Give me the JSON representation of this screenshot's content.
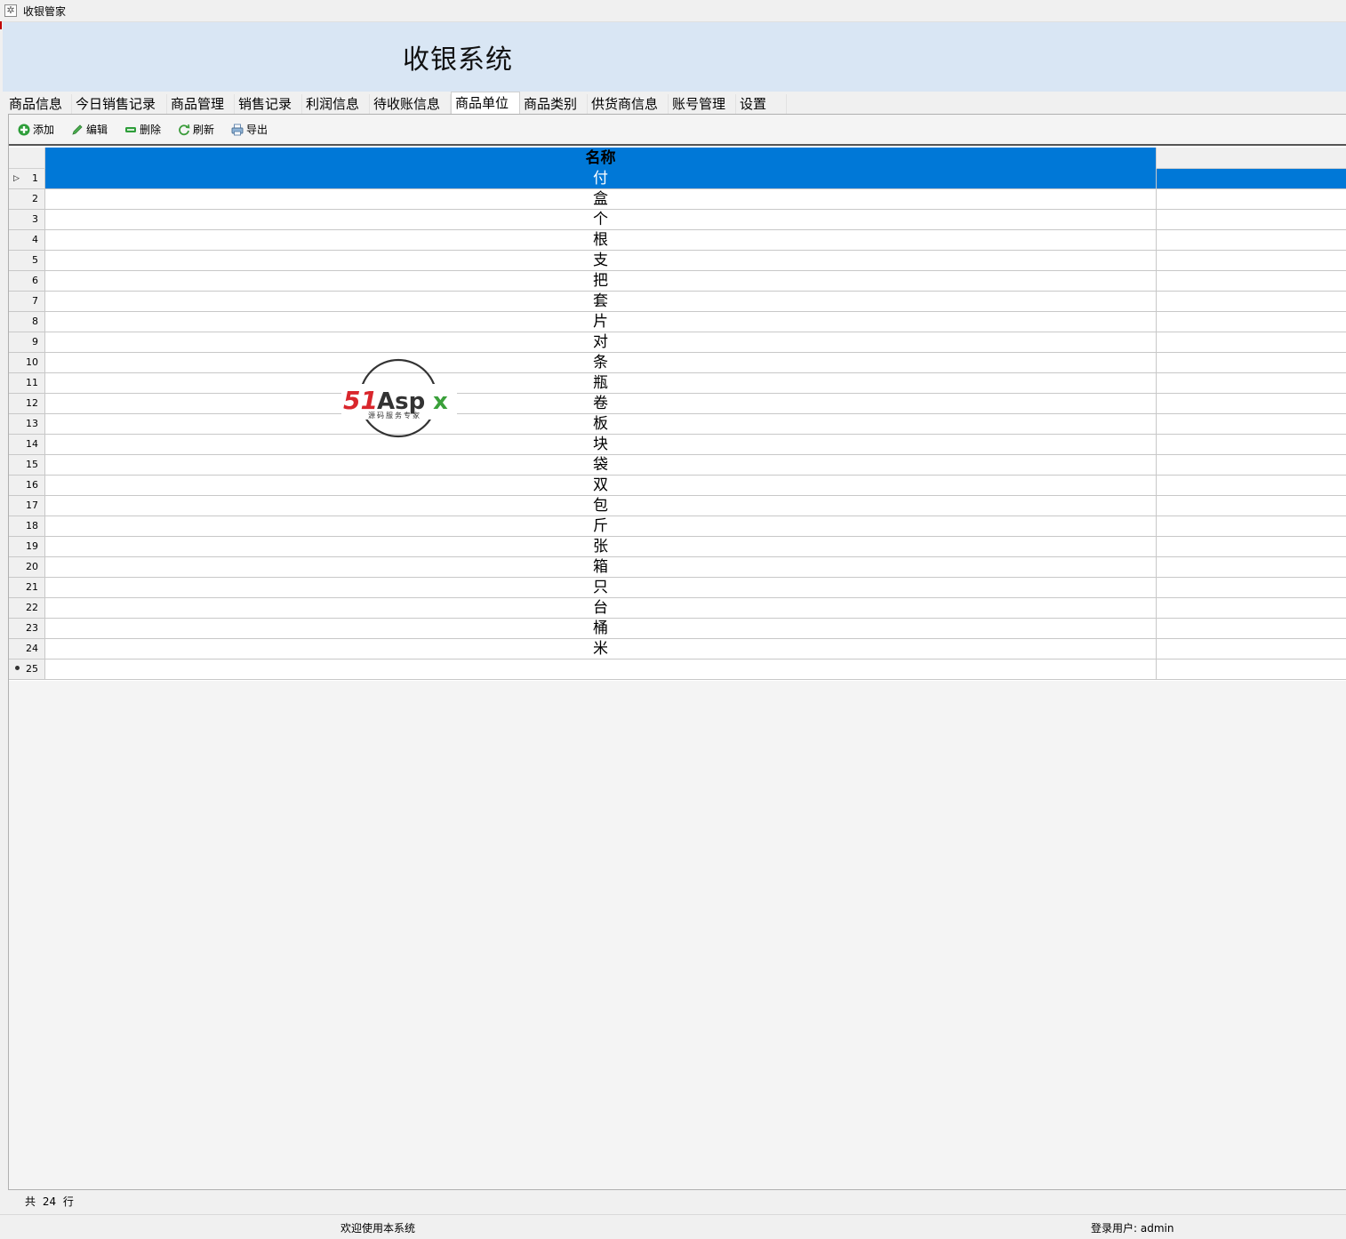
{
  "window": {
    "title": "收银管家",
    "app_icon": "gear-icon"
  },
  "banner": {
    "title": "收银系统"
  },
  "tabs": [
    {
      "label": "商品信息",
      "active": false
    },
    {
      "label": "今日销售记录",
      "active": false
    },
    {
      "label": "商品管理",
      "active": false
    },
    {
      "label": "销售记录",
      "active": false
    },
    {
      "label": "利润信息",
      "active": false
    },
    {
      "label": "待收账信息",
      "active": false
    },
    {
      "label": "商品单位",
      "active": true
    },
    {
      "label": "商品类别",
      "active": false
    },
    {
      "label": "供货商信息",
      "active": false
    },
    {
      "label": "账号管理",
      "active": false
    },
    {
      "label": "设置",
      "active": false
    }
  ],
  "toolbar": {
    "add_label": "添加",
    "edit_label": "编辑",
    "delete_label": "删除",
    "refresh_label": "刷新",
    "export_label": "导出"
  },
  "grid": {
    "column_name": "名称",
    "rows": [
      "付",
      "盒",
      "个",
      "根",
      "支",
      "把",
      "套",
      "片",
      "对",
      "条",
      "瓶",
      "卷",
      "板",
      "块",
      "袋",
      "双",
      "包",
      "斤",
      "张",
      "箱",
      "只",
      "台",
      "桶",
      "米"
    ],
    "selected_row": 1,
    "new_row_number": "25"
  },
  "footer": {
    "count_text": "共 24 行"
  },
  "status": {
    "welcome": "欢迎使用本系统",
    "login_user": "登录用户: admin"
  },
  "watermark": {
    "brand_a": "51",
    "brand_b": "Aspx",
    "tagline": "源码服务专家"
  },
  "colors": {
    "selection": "#0078d7",
    "banner": "#d9e6f4"
  }
}
